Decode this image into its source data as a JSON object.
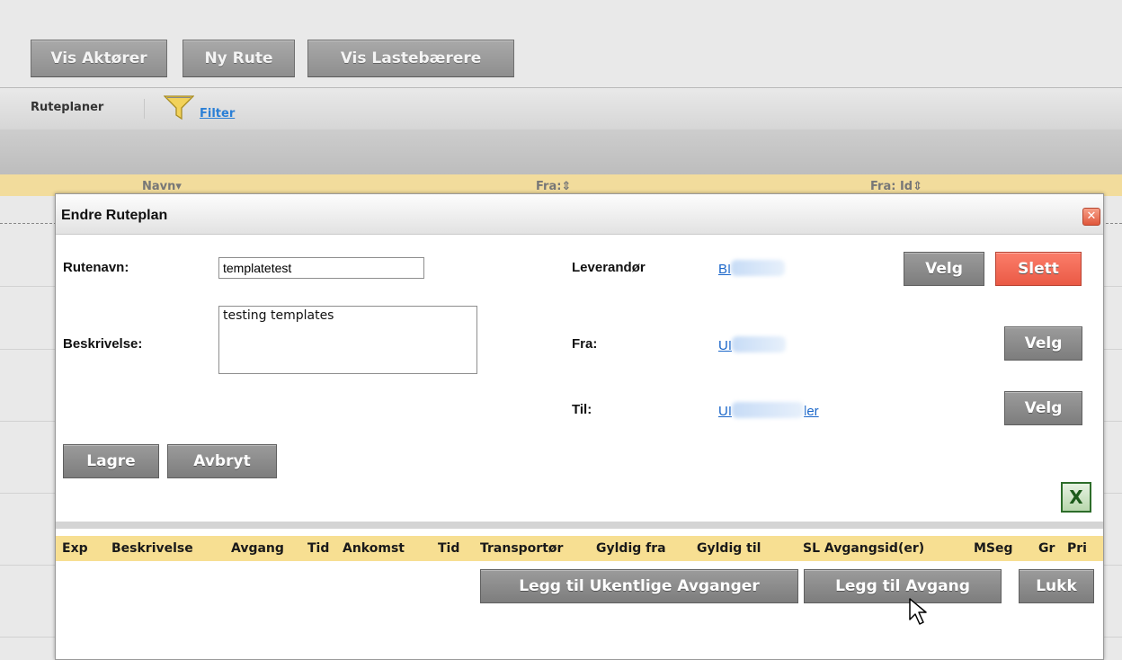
{
  "top_buttons": {
    "actors": "Vis Aktører",
    "new_route": "Ny Rute",
    "carriers": "Vis Lastebærere"
  },
  "toolbar": {
    "label": "Ruteplaner",
    "filter": "Filter"
  },
  "grid_header": {
    "name": "Navn▾",
    "from": "Fra:⇕",
    "from_id": "Fra: Id⇕"
  },
  "dialog": {
    "title": "Endre Ruteplan",
    "close_glyph": "✕",
    "route_name_label": "Rutenavn:",
    "route_name_value": "templatetest",
    "description_label": "Beskrivelse:",
    "description_value": "testing templates",
    "supplier_label": "Leverandør",
    "supplier_value": "BI",
    "from_label": "Fra:",
    "from_value": "UI",
    "to_label": "Til:",
    "to_value_prefix": "UI",
    "to_value_suffix": "ler",
    "select_label": "Velg",
    "delete_label": "Slett",
    "save_label": "Lagre",
    "cancel_label": "Avbryt",
    "excel_glyph": "X",
    "columns": [
      "Exp",
      "Beskrivelse",
      "Avgang",
      "Tid",
      "Ankomst",
      "Tid",
      "Transportør",
      "Gyldig fra",
      "Gyldig til",
      "SL Avgangsid(er)",
      "MSeg",
      "Gr",
      "Pri"
    ],
    "add_weekly_label": "Legg til Ukentlige Avganger",
    "add_departure_label": "Legg til Avgang",
    "close_label": "Lukk"
  },
  "colors": {
    "accent_delete": "#ea5a45",
    "header_yellow": "#f7df92",
    "link": "#1a66c9"
  }
}
